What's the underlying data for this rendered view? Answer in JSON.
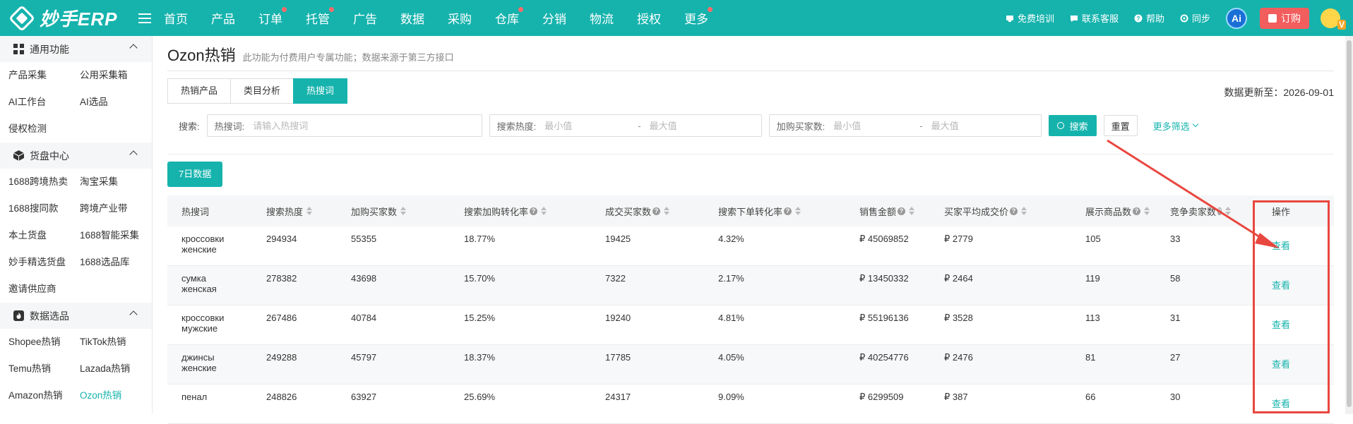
{
  "app": {
    "logo_text": "妙手ERP"
  },
  "topnav": {
    "items": [
      {
        "label": "首页",
        "dot": false
      },
      {
        "label": "产品",
        "dot": false
      },
      {
        "label": "订单",
        "dot": true
      },
      {
        "label": "托管",
        "dot": true
      },
      {
        "label": "广告",
        "dot": false
      },
      {
        "label": "数据",
        "dot": false
      },
      {
        "label": "采购",
        "dot": false
      },
      {
        "label": "仓库",
        "dot": true
      },
      {
        "label": "分销",
        "dot": false
      },
      {
        "label": "物流",
        "dot": false
      },
      {
        "label": "授权",
        "dot": false
      },
      {
        "label": "更多",
        "dot": true
      }
    ],
    "tools": {
      "training": "免费培训",
      "support": "联系客服",
      "help": "帮助",
      "sync": "同步",
      "ai": "Ai",
      "order": "订购"
    }
  },
  "sidebar": {
    "groups": [
      {
        "title": "通用功能",
        "icon": "grid-icon",
        "items": [
          "产品采集",
          "公用采集箱",
          "AI工作台",
          "AI选品",
          "侵权检测"
        ]
      },
      {
        "title": "货盘中心",
        "icon": "box-icon",
        "items": [
          "1688跨境热卖",
          "淘宝采集",
          "1688搜同款",
          "跨境产业带",
          "本土货盘",
          "1688智能采集",
          "妙手精选货盘",
          "1688选品库",
          "邀请供应商"
        ]
      },
      {
        "title": "数据选品",
        "icon": "fire-icon",
        "items": [
          "Shopee热销",
          "TikTok热销",
          "Temu热销",
          "Lazada热销",
          "Amazon热销",
          "Ozon热销"
        ]
      }
    ],
    "active_item": "Ozon热销"
  },
  "page": {
    "title": "Ozon热销",
    "subtitle": "此功能为付费用户专属功能；数据来源于第三方接口",
    "tabs": [
      "热销产品",
      "类目分析",
      "热搜词"
    ],
    "active_tab": "热搜词",
    "updated_label": "数据更新至：2026-09-01"
  },
  "filters": {
    "label": "搜索:",
    "keyword": {
      "key": "热搜词:",
      "placeholder": "请输入热搜词"
    },
    "heat": {
      "key": "搜索热度:",
      "min_placeholder": "最小值",
      "max_placeholder": "最大值"
    },
    "buyers": {
      "key": "加购买家数:",
      "min_placeholder": "最小值",
      "max_placeholder": "最大值"
    },
    "search_button": "搜索",
    "reset_button": "重置",
    "more_filters": "更多筛选"
  },
  "period_button": "7日数据",
  "table": {
    "columns": [
      {
        "label": "热搜词",
        "help": false,
        "sort": false
      },
      {
        "label": "搜索热度",
        "help": false,
        "sort": true
      },
      {
        "label": "加购买家数",
        "help": false,
        "sort": true
      },
      {
        "label": "搜索加购转化率",
        "help": true,
        "sort": true
      },
      {
        "label": "成交买家数",
        "help": true,
        "sort": true
      },
      {
        "label": "搜索下单转化率",
        "help": true,
        "sort": true
      },
      {
        "label": "销售金额",
        "help": true,
        "sort": true
      },
      {
        "label": "买家平均成交价",
        "help": true,
        "sort": true
      },
      {
        "label": "展示商品数",
        "help": true,
        "sort": true
      },
      {
        "label": "竞争卖家数",
        "help": true,
        "sort": true
      },
      {
        "label": "操作",
        "help": false,
        "sort": false
      }
    ],
    "rows": [
      {
        "keyword": [
          "кроссовки",
          "женские"
        ],
        "heat": "294934",
        "cart_buyers": "55355",
        "cart_rate": "18.77%",
        "deal_buyers": "19425",
        "order_rate": "4.32%",
        "sales": "₽ 45069852",
        "avg_price": "₽ 2779",
        "products": "105",
        "sellers": "33",
        "action": "查看"
      },
      {
        "keyword": [
          "сумка",
          "женская"
        ],
        "heat": "278382",
        "cart_buyers": "43698",
        "cart_rate": "15.70%",
        "deal_buyers": "7322",
        "order_rate": "2.17%",
        "sales": "₽ 13450332",
        "avg_price": "₽ 2464",
        "products": "119",
        "sellers": "58",
        "action": "查看"
      },
      {
        "keyword": [
          "кроссовки",
          "мужские"
        ],
        "heat": "267486",
        "cart_buyers": "40784",
        "cart_rate": "15.25%",
        "deal_buyers": "19240",
        "order_rate": "4.81%",
        "sales": "₽ 55196136",
        "avg_price": "₽ 3528",
        "products": "113",
        "sellers": "31",
        "action": "查看"
      },
      {
        "keyword": [
          "джинсы",
          "женские"
        ],
        "heat": "249288",
        "cart_buyers": "45797",
        "cart_rate": "18.37%",
        "deal_buyers": "17785",
        "order_rate": "4.05%",
        "sales": "₽ 40254776",
        "avg_price": "₽ 2476",
        "products": "81",
        "sellers": "27",
        "action": "查看"
      },
      {
        "keyword": [
          "пенал",
          ""
        ],
        "heat": "248826",
        "cart_buyers": "63927",
        "cart_rate": "25.69%",
        "deal_buyers": "24317",
        "order_rate": "9.09%",
        "sales": "₽ 6299509",
        "avg_price": "₽ 387",
        "products": "66",
        "sellers": "30",
        "action": "查看"
      }
    ]
  },
  "colors": {
    "brand": "#16b3ad",
    "annotation": "#e8473f",
    "order_button": "#f25d5d"
  }
}
